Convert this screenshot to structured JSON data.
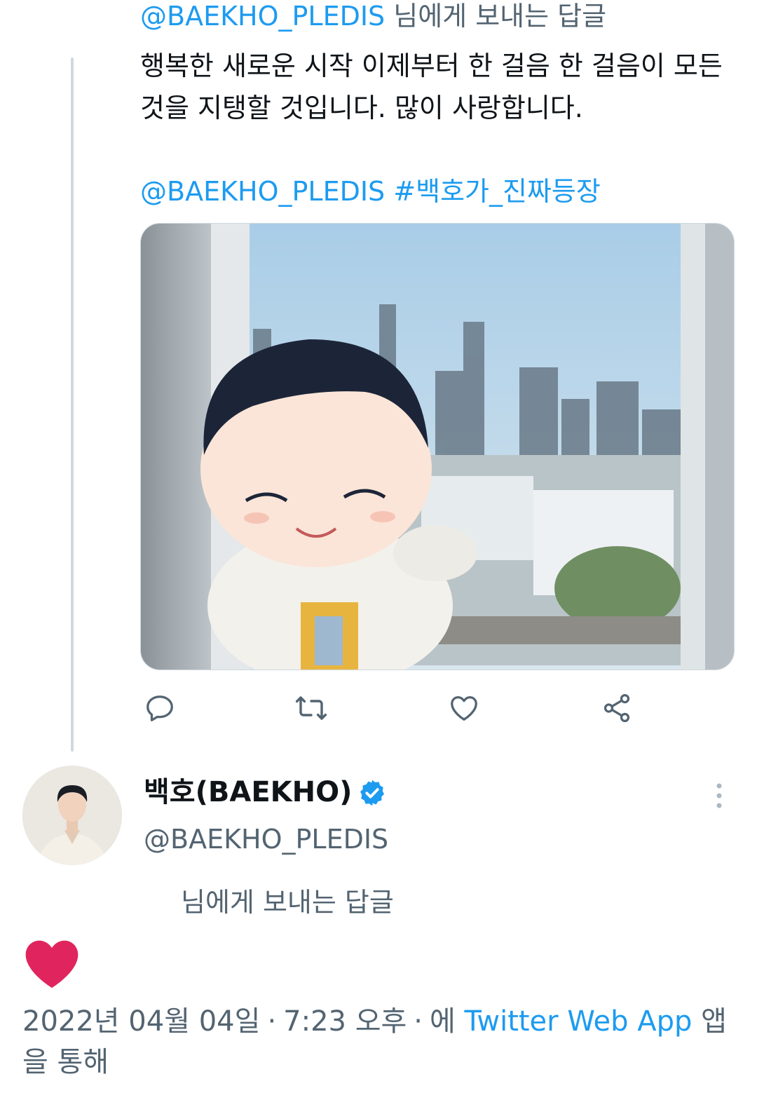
{
  "reply_header": {
    "mention": "@BAEKHO_PLEDIS",
    "suffix": " 님에게 보내는 답글"
  },
  "tweet": {
    "line1": "행복한 새로운 시작  이제부터 한 걸음 한 걸음이 모든",
    "line2": "것을 지탱할 것입니다. 많이 사랑합니다.",
    "mention": "@BAEKHO_PLEDIS",
    "hashtag": "#백호가_진짜등장"
  },
  "actions": {
    "icons": [
      "reply-icon",
      "retweet-icon",
      "like-icon",
      "share-icon"
    ],
    "color": "#536471"
  },
  "author": {
    "display_name": "백호(BAEKHO)",
    "handle": "@BAEKHO_PLEDIS",
    "verified": true,
    "verified_color": "#1d9bf0"
  },
  "reply_note": "님에게 보내는 답글",
  "liked": true,
  "like_color": "#e0245e",
  "meta": {
    "date": "2022년 04월 04일",
    "time": "7:23 오후",
    "via_prefix": "에",
    "source": "Twitter Web App",
    "via_suffix": "앱을 통해"
  },
  "colors": {
    "link": "#1d9bf0",
    "secondary_text": "#536471",
    "thread_line": "#cfd9de"
  }
}
